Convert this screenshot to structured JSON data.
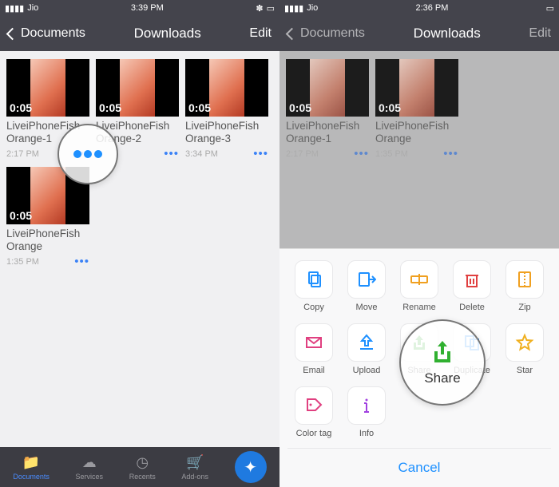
{
  "left": {
    "status": {
      "carrier": "Jio",
      "time": "3:39 PM",
      "bluetooth": true
    },
    "nav": {
      "back": "Documents",
      "title": "Downloads",
      "edit": "Edit"
    },
    "files": [
      {
        "name": "LiveiPhoneFish Orange-1",
        "time": "2:17 PM",
        "duration": "0:05"
      },
      {
        "name": "LiveiPhoneFish Orange-2",
        "time": "",
        "duration": "0:05"
      },
      {
        "name": "LiveiPhoneFish Orange-3",
        "time": "3:34 PM",
        "duration": "0:05"
      },
      {
        "name": "LiveiPhoneFish Orange",
        "time": "1:35 PM",
        "duration": "0:05"
      }
    ],
    "more_label": "•••",
    "tabs": [
      "Documents",
      "Services",
      "Recents",
      "Add-ons",
      ""
    ]
  },
  "right": {
    "status": {
      "carrier": "Jio",
      "time": "2:36 PM"
    },
    "nav": {
      "back": "Documents",
      "title": "Downloads",
      "edit": "Edit"
    },
    "files": [
      {
        "name": "LiveiPhoneFish Orange-1",
        "time": "2:17 PM",
        "duration": "0:05"
      },
      {
        "name": "LiveiPhoneFish Orange",
        "time": "1:35 PM",
        "duration": "0:05"
      }
    ],
    "more_label": "•••",
    "sheet": {
      "items": [
        {
          "label": "Copy",
          "color": "#1e90ff"
        },
        {
          "label": "Move",
          "color": "#1e90ff"
        },
        {
          "label": "Rename",
          "color": "#f0a020"
        },
        {
          "label": "Delete",
          "color": "#e04040"
        },
        {
          "label": "Zip",
          "color": "#f0a020"
        },
        {
          "label": "Email",
          "color": "#e04080"
        },
        {
          "label": "Upload",
          "color": "#1e90ff"
        },
        {
          "label": "Share",
          "color": "#30b030"
        },
        {
          "label": "Duplicate",
          "color": "#1e90ff"
        },
        {
          "label": "Star",
          "color": "#f0b020"
        },
        {
          "label": "Color tag",
          "color": "#e04080"
        },
        {
          "label": "Info",
          "color": "#a040e0"
        }
      ],
      "cancel": "Cancel",
      "highlight_label": "Share"
    }
  }
}
